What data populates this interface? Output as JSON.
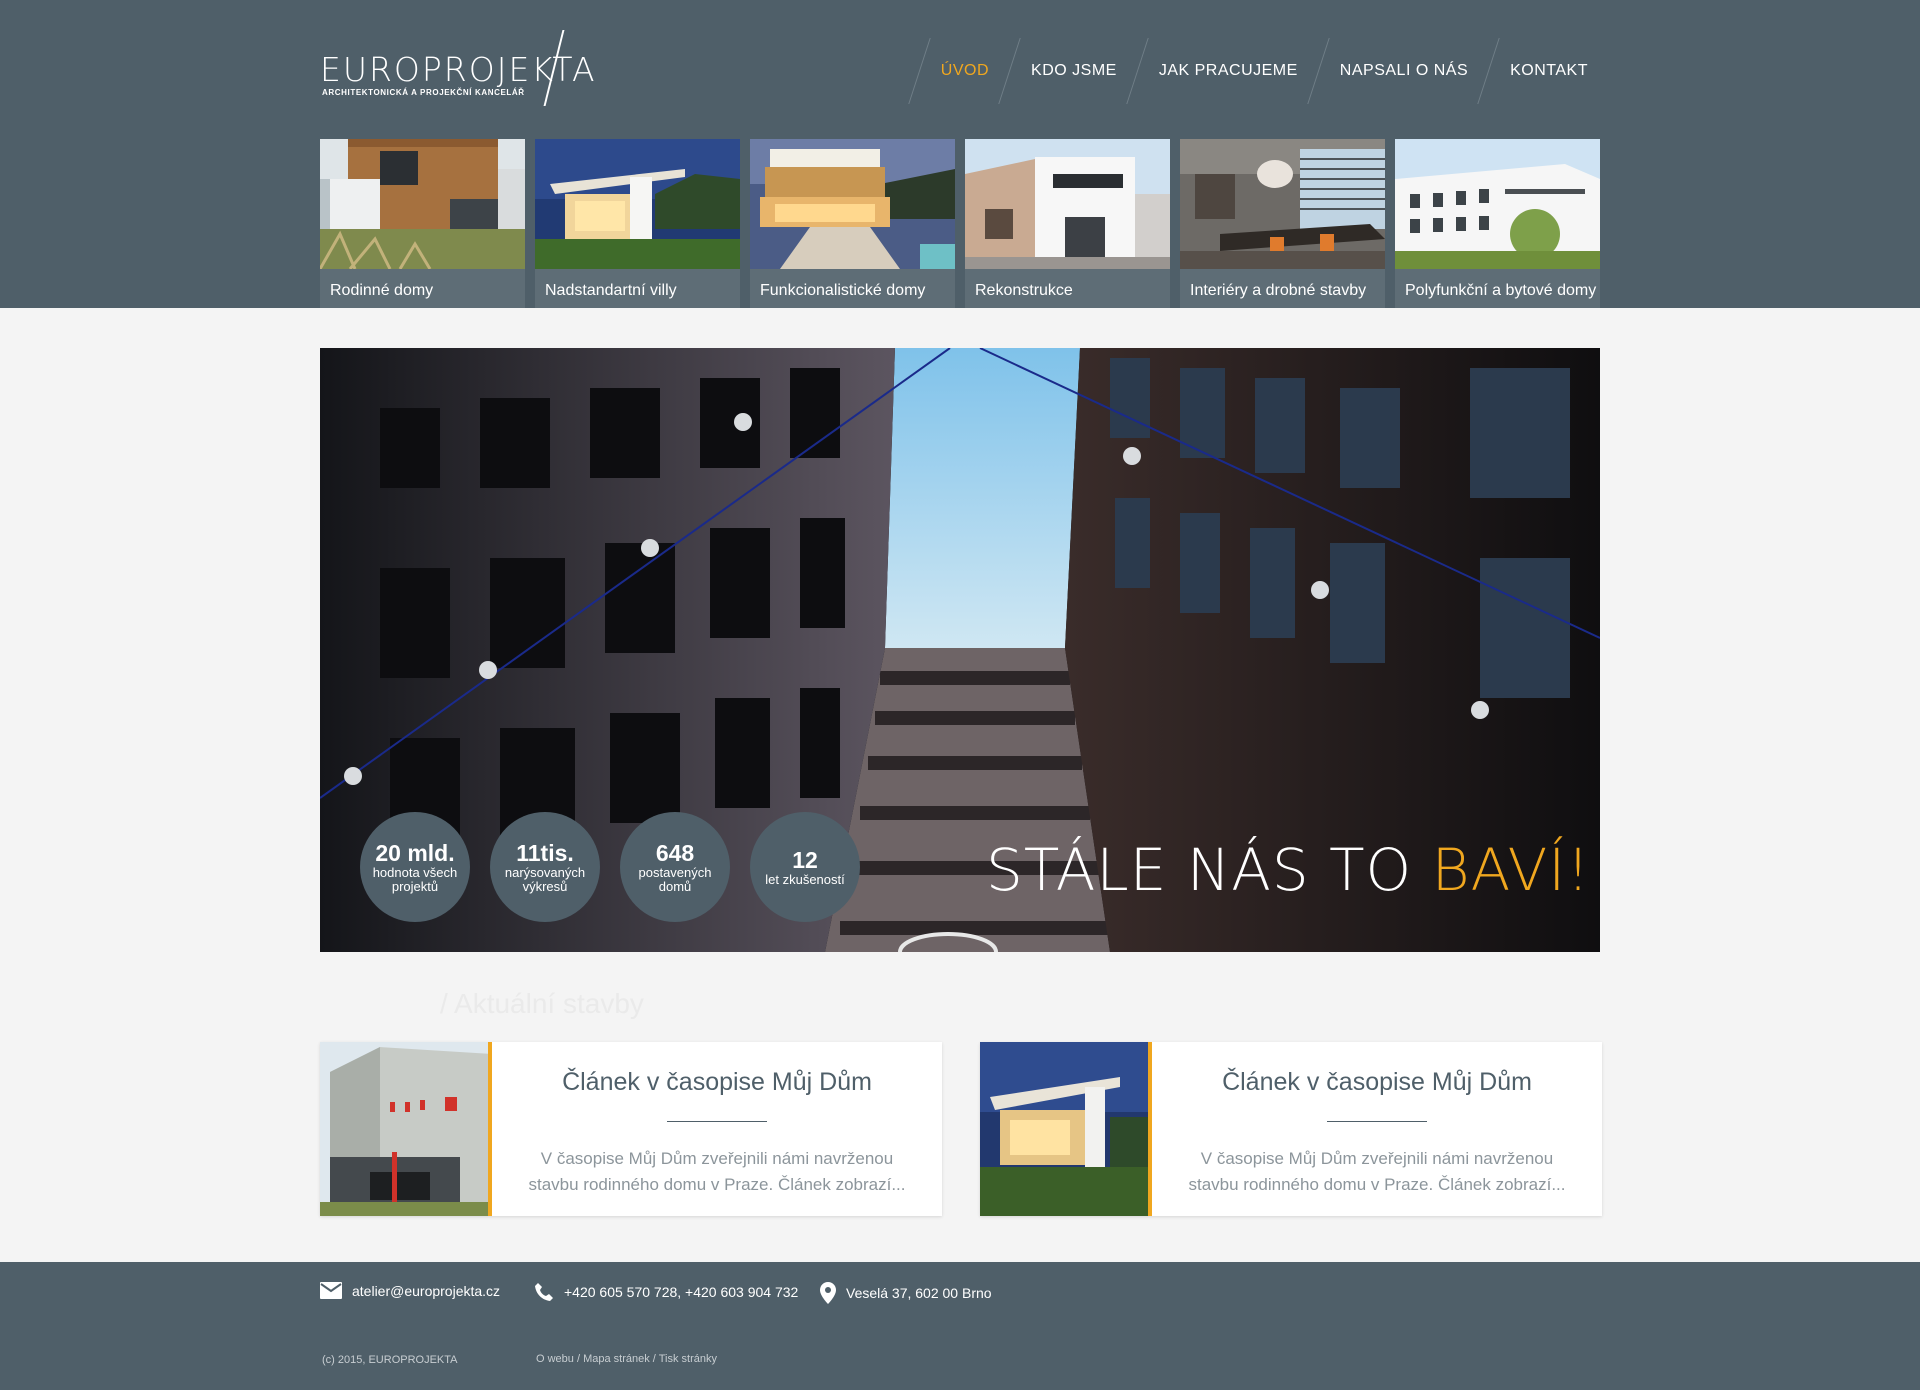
{
  "brand": {
    "name": "EUROPROJEKTA",
    "tagline": "ARCHITEKTONICKÁ A PROJEKČNÍ KANCELÁŘ"
  },
  "nav": [
    {
      "label": "ÚVOD",
      "active": true
    },
    {
      "label": "KDO JSME",
      "active": false
    },
    {
      "label": "JAK PRACUJEME",
      "active": false
    },
    {
      "label": "NAPSALI O NÁS",
      "active": false
    },
    {
      "label": "KONTAKT",
      "active": false
    }
  ],
  "categories": [
    {
      "label": "Rodinné domy"
    },
    {
      "label": "Nadstandartní villy"
    },
    {
      "label": "Funkcionalistické domy"
    },
    {
      "label": "Rekonstrukce"
    },
    {
      "label": "Interiéry a drobné stavby"
    },
    {
      "label": "Polyfunkční a bytové domy"
    }
  ],
  "hero": {
    "slogan_main": "STÁLE NÁS TO ",
    "slogan_accent": "BAVÍ!",
    "stats": [
      {
        "value": "20 mld.",
        "label": "hodnota všech projektů"
      },
      {
        "value": "11tis.",
        "label": "narýsovaných výkresů"
      },
      {
        "value": "648",
        "label": "postavených domů"
      },
      {
        "value": "12",
        "label": "let zkušeností"
      }
    ]
  },
  "section": {
    "title": "/ Aktuální stavby"
  },
  "cards": [
    {
      "title": "Článek v časopise Můj Dům",
      "text": "V časopise Můj Dům zveřejnili námi navrženou stavbu rodinného domu v Praze. Článek zobrazí..."
    },
    {
      "title": "Článek v časopise Můj Dům",
      "text": "V časopise Můj Dům zveřejnili námi navrženou stavbu rodinného domu v Praze. Článek zobrazí..."
    }
  ],
  "footer": {
    "email": "atelier@europrojekta.cz",
    "phone": "+420 605 570 728, +420 603 904 732",
    "address": "Veselá 37, 602 00 Brno",
    "copyright": "(c) 2015, EUROPROJEKTA",
    "links": [
      "O webu",
      "Mapa stránek",
      "Tisk stránky"
    ],
    "link_separator": " / "
  },
  "colors": {
    "header_bg": "#4f5f69",
    "accent": "#f0a71f",
    "page_bg": "#f4f4f4"
  },
  "icons": {
    "email": "envelope-icon",
    "phone": "phone-icon",
    "address": "location-pin-icon"
  }
}
